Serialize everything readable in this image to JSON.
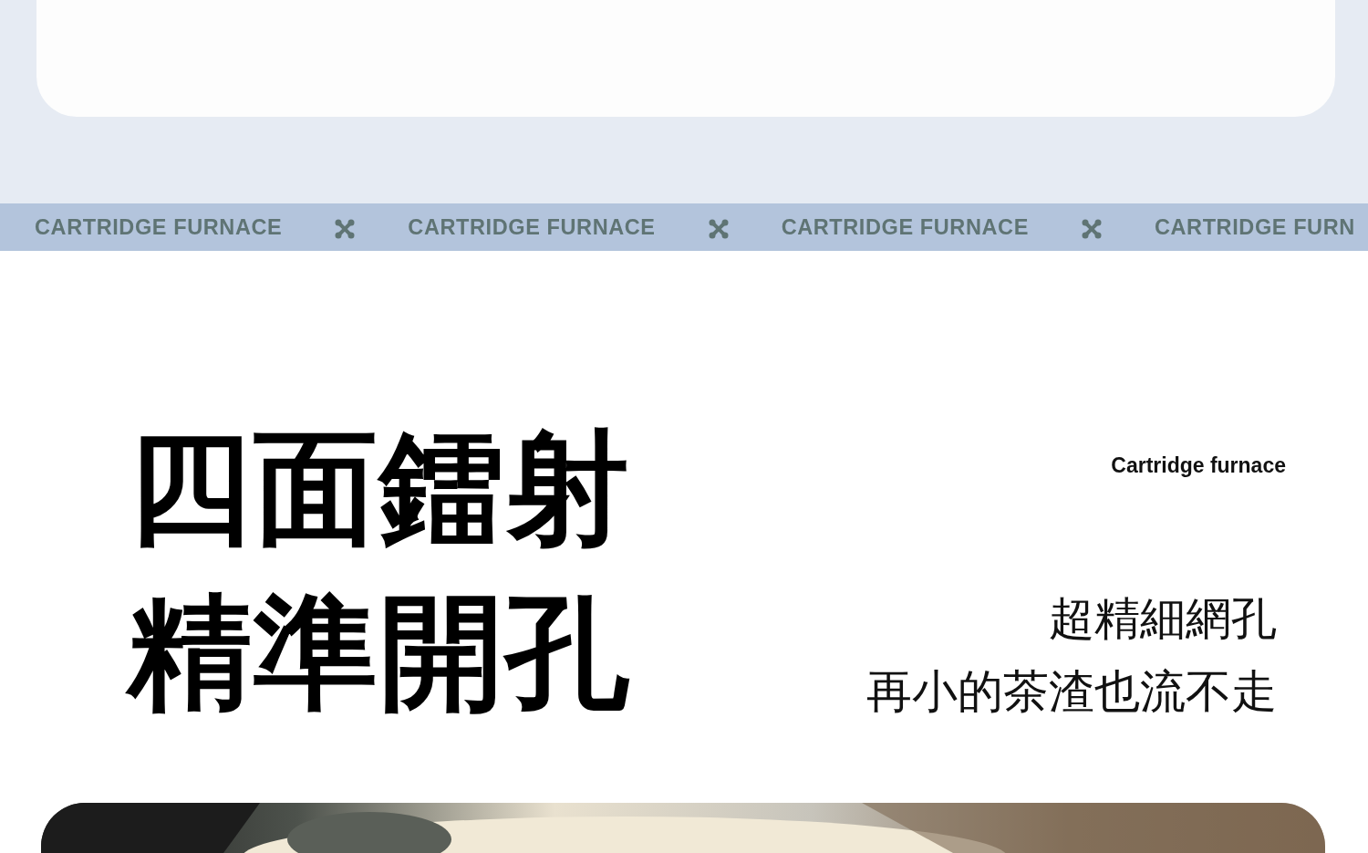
{
  "ticker": [
    "CARTRIDGE FURNACE",
    "CARTRIDGE FURNACE",
    "CARTRIDGE FURNACE",
    "CARTRIDGE FURN"
  ],
  "headline": [
    "四面鐳射",
    "精準開孔"
  ],
  "subtitle": "Cartridge furnace",
  "tagline": [
    "超精細網孔",
    "再小的茶渣也流不走"
  ]
}
